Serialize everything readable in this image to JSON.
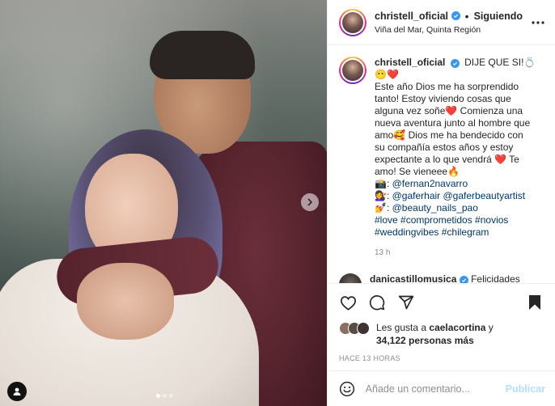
{
  "post": {
    "username": "christell_oficial",
    "follow_state": "Siguiendo",
    "separator": "•",
    "location": "Viña del Mar, Quinta Región",
    "carousel": {
      "slide_count": 3,
      "active_slide": 1
    }
  },
  "caption": {
    "username": "christell_oficial",
    "lines": [
      "DIJE QUE SI!💍",
      "😶❤️",
      "Este año Dios me ha sorprendido",
      "tanto! Estoy viviendo cosas que",
      "alguna vez soñe❤️ Comienza una",
      "nueva aventura junto al hombre que",
      "amo🥰 Dios me ha bendecido con",
      "su compañía estos años y estoy",
      "expectante a lo que vendrá ❤️ Te",
      "amo! Se vieneee🔥"
    ],
    "credits": [
      {
        "emoji": "📸:",
        "mentions": "@fernan2navarro"
      },
      {
        "emoji": "💇‍♀️:",
        "mentions": "@gaferhair @gaferbeautyartist"
      },
      {
        "emoji": "💅:",
        "mentions": "@beauty_nails_pao"
      }
    ],
    "hashtags_line1": "#love #comprometidos #novios",
    "hashtags_line2": "#weddingvibes #chilegram",
    "time": "13 h"
  },
  "next_comment": {
    "username": "danicastillomusica",
    "text": "Felicidades"
  },
  "likes": {
    "prefix": "Les gusta a",
    "first_liker": "caelacortina",
    "connector": "y",
    "count_text": "34,122 personas más"
  },
  "posted_ago": "HACE 13 HORAS",
  "comment_box": {
    "placeholder": "Añade un comentario...",
    "publish_label": "Publicar"
  },
  "colors": {
    "link": "#00376b",
    "verified": "#3897f0",
    "publish_disabled": "#b2dffc",
    "secondary_text": "#8e8e8e"
  },
  "icons": [
    "verified-badge-icon",
    "more-options-icon",
    "like-heart-icon",
    "comment-icon",
    "share-icon",
    "save-bookmark-icon",
    "emoji-icon",
    "next-arrow-icon",
    "user-tag-icon"
  ]
}
